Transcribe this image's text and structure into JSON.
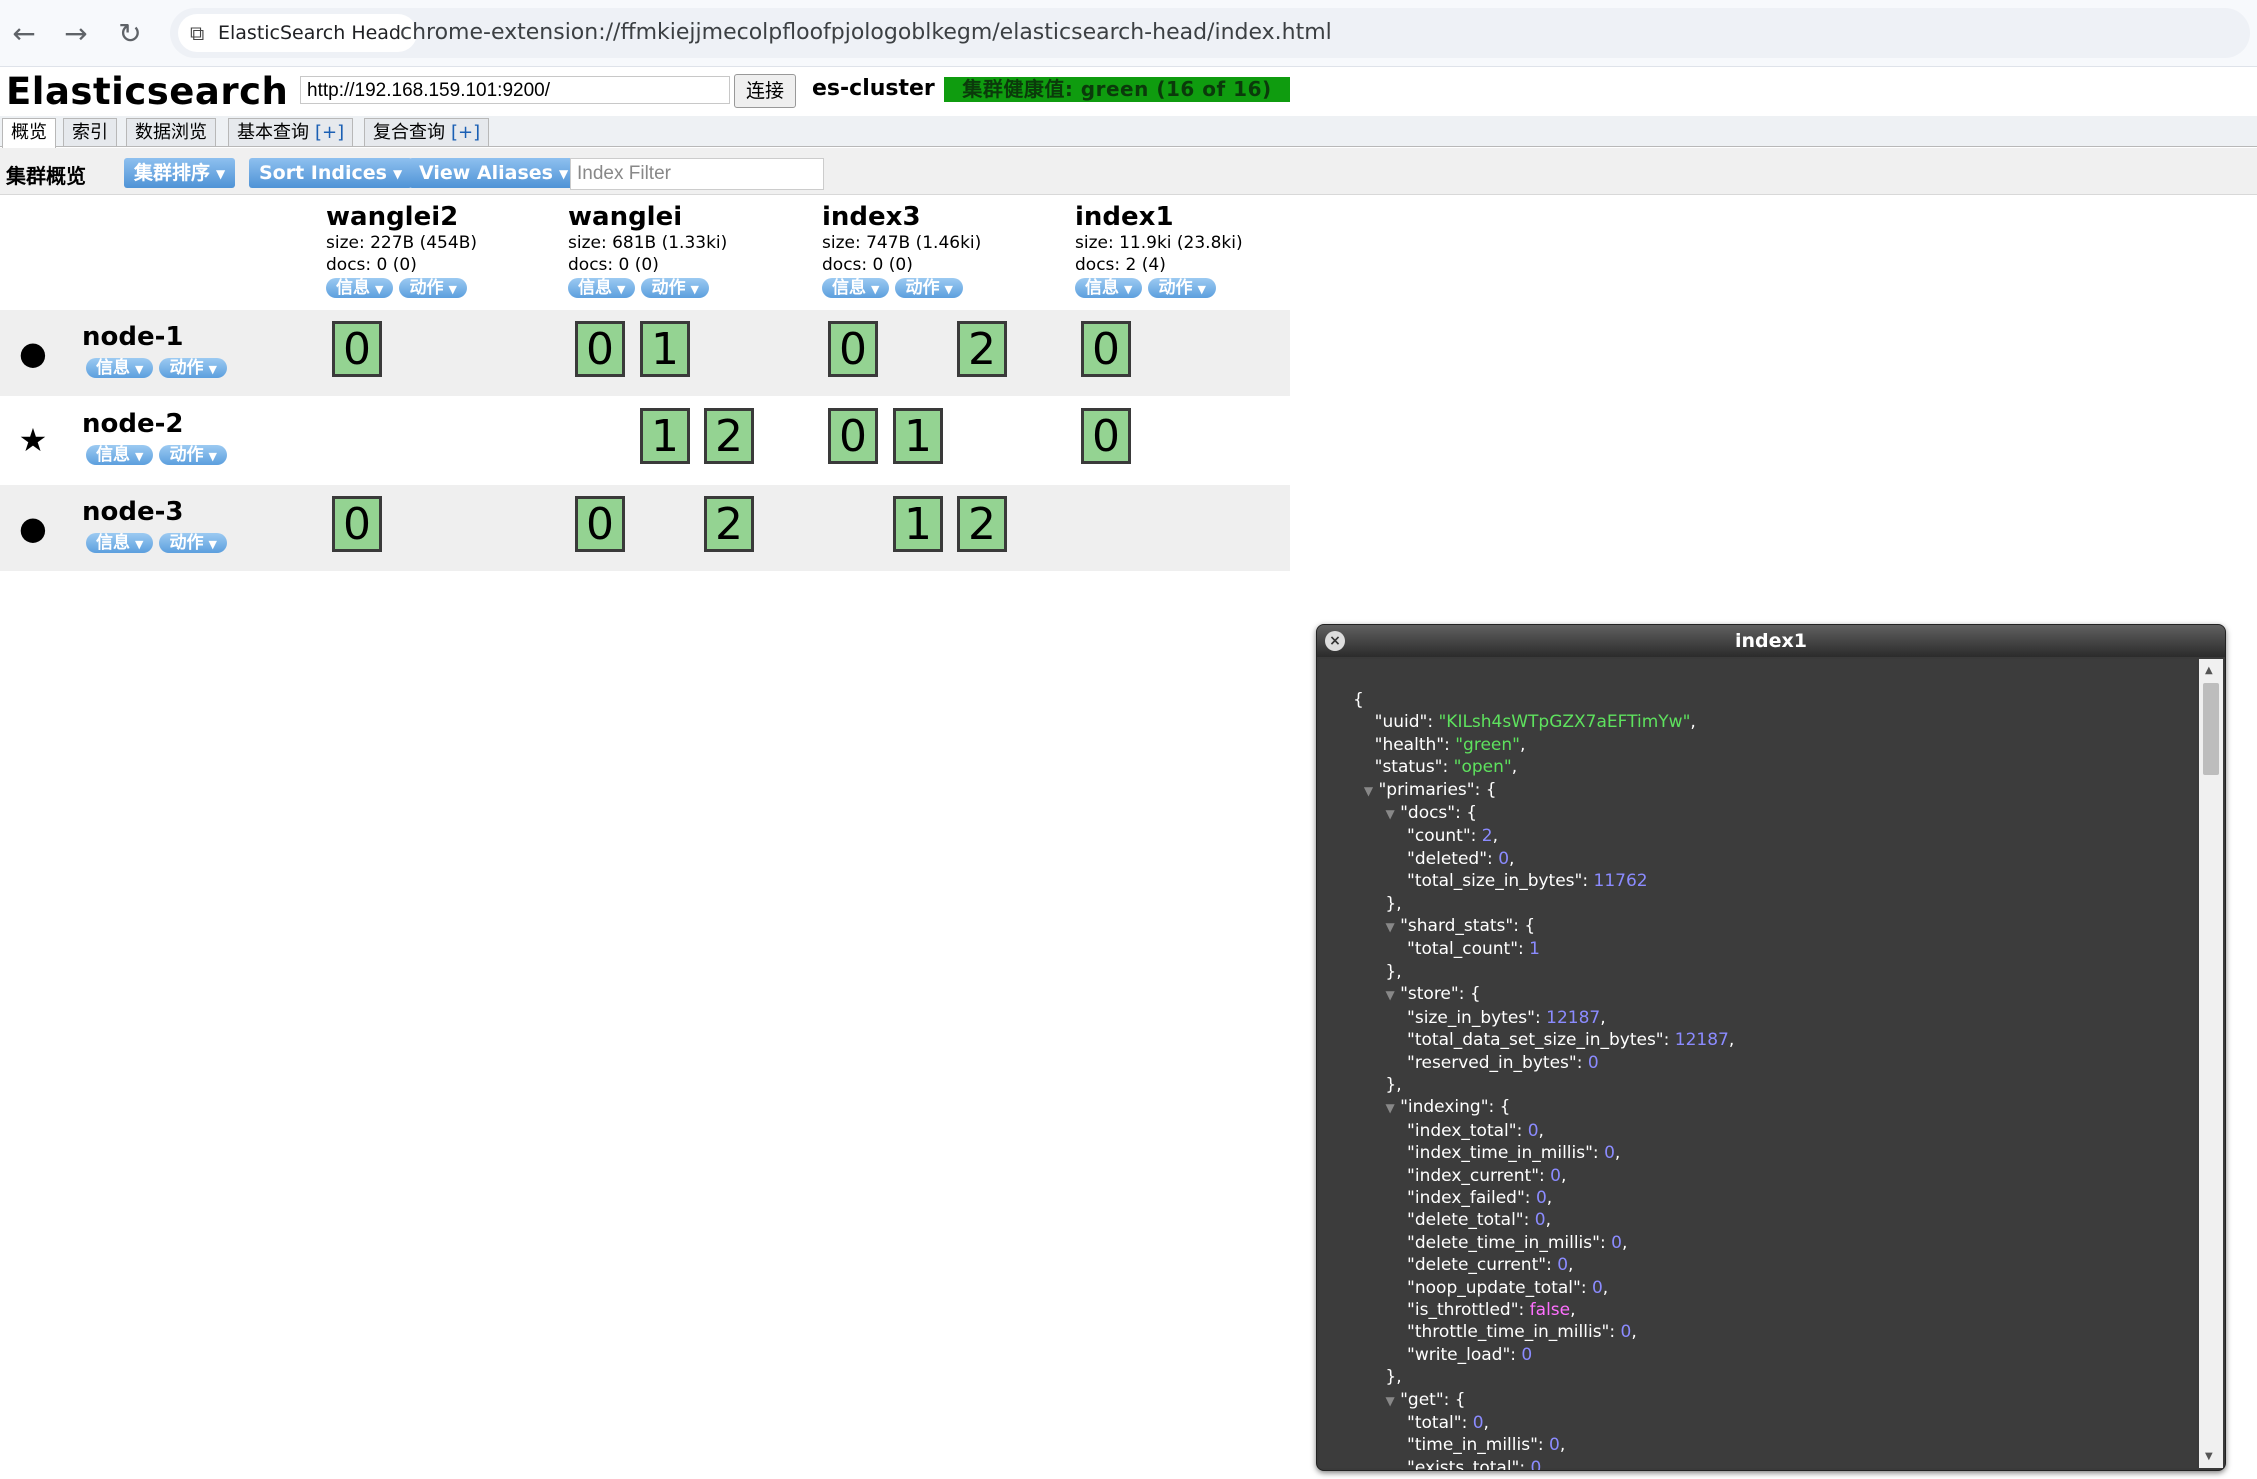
{
  "browser": {
    "tab_title": "ElasticSearch Head",
    "url": "chrome-extension://ffmkiejjmecolpfloofpjologoblkegm/elasticsearch-head/index.html"
  },
  "header": {
    "title": "Elasticsearch",
    "es_url": "http://192.168.159.101:9200/",
    "connect_label": "连接",
    "cluster_name": "es-cluster",
    "health": "集群健康值: green (16 of 16)",
    "health_color": "#0f9c0f"
  },
  "tabs": [
    {
      "label": "概览",
      "plus": ""
    },
    {
      "label": "索引",
      "plus": ""
    },
    {
      "label": "数据浏览",
      "plus": ""
    },
    {
      "label": "基本查询",
      "plus": "[+]"
    },
    {
      "label": "复合查询",
      "plus": "[+]"
    }
  ],
  "toolbar": {
    "label": "集群概览",
    "sort_cluster": "集群排序",
    "sort_indices": "Sort Indices",
    "view_aliases": "View Aliases",
    "filter_placeholder": "Index Filter"
  },
  "buttons": {
    "info": "信息",
    "action": "动作"
  },
  "indices": [
    {
      "name": "wanglei2",
      "size": "size: 227B (454B)",
      "docs": "docs: 0 (0)"
    },
    {
      "name": "wanglei",
      "size": "size: 681B (1.33ki)",
      "docs": "docs: 0 (0)"
    },
    {
      "name": "index3",
      "size": "size: 747B (1.46ki)",
      "docs": "docs: 0 (0)"
    },
    {
      "name": "index1",
      "size": "size: 11.9ki (23.8ki)",
      "docs": "docs: 2 (4)"
    }
  ],
  "nodes": [
    {
      "name": "node-1",
      "marker": "●"
    },
    {
      "name": "node-2",
      "marker": "★"
    },
    {
      "name": "node-3",
      "marker": "●"
    }
  ],
  "shards": {
    "n1_wanglei2_0": "0",
    "n1_wanglei_0": "0",
    "n1_wanglei_1": "1",
    "n1_index3_0": "0",
    "n1_index3_2": "2",
    "n1_index1_0": "0",
    "n2_wanglei_1": "1",
    "n2_wanglei_2": "2",
    "n2_index3_0": "0",
    "n2_index3_1": "1",
    "n2_index1_0": "0",
    "n3_wanglei2_0": "0",
    "n3_wanglei_0": "0",
    "n3_wanglei_2": "2",
    "n3_index3_1": "1",
    "n3_index3_2": "2"
  },
  "dialog": {
    "title": "index1",
    "uuid": "KILsh4sWTpGZX7aEFTimYw",
    "health": "green",
    "status": "open",
    "docs_count": "2",
    "docs_deleted": "0",
    "docs_total_size_in_bytes": "11762",
    "shard_total_count": "1",
    "store_size_in_bytes": "12187",
    "store_total_data_set_size_in_bytes": "12187",
    "store_reserved_in_bytes": "0",
    "index_total": "0",
    "index_time_in_millis": "0",
    "index_current": "0",
    "index_failed": "0",
    "delete_total": "0",
    "delete_time_in_millis": "0",
    "delete_current": "0",
    "noop_update_total": "0",
    "is_throttled": "false",
    "throttle_time_in_millis": "0",
    "write_load": "0",
    "get_total": "0",
    "get_time_in_millis": "0",
    "get_exists_total": "0"
  }
}
